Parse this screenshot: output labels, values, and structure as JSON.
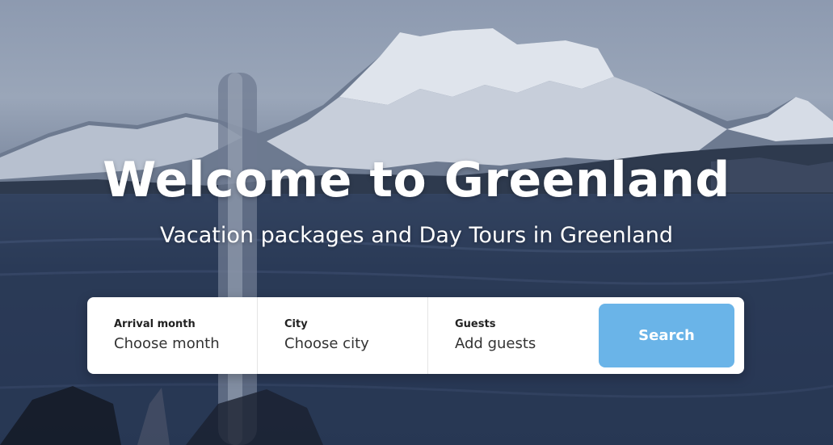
{
  "hero": {
    "title": "Welcome to Greenland",
    "subtitle": "Vacation packages and Day Tours in Greenland"
  },
  "search": {
    "fields": [
      {
        "label": "Arrival month",
        "value": "Choose month"
      },
      {
        "label": "City",
        "value": "Choose city"
      },
      {
        "label": "Guests",
        "value": "Add guests"
      }
    ],
    "button_label": "Search"
  },
  "colors": {
    "button": "#6ab4e8",
    "text": "#ffffff",
    "sea": "#2c3b57"
  }
}
